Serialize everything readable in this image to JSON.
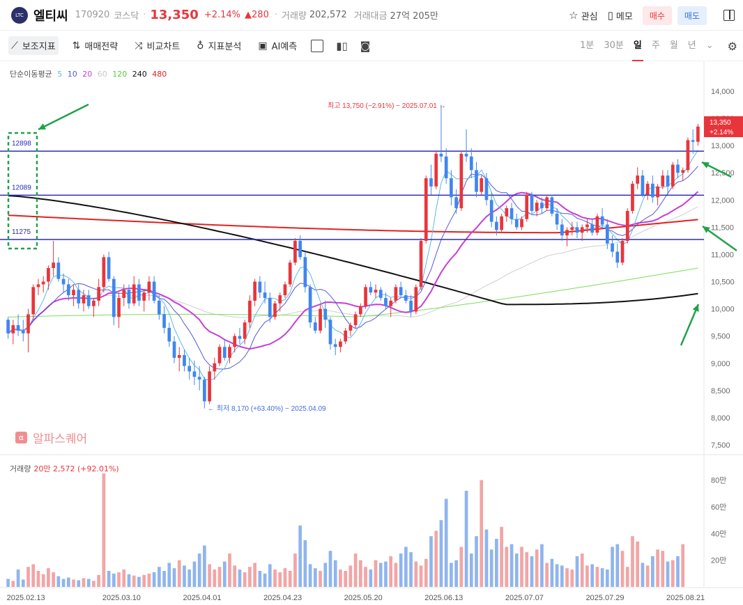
{
  "header": {
    "logo_text": "LTC",
    "name": "엘티씨",
    "code": "170920",
    "market": "코스닥",
    "dot": "·",
    "price": "13,350",
    "change_pct": "+2.14%",
    "change": "▲280",
    "volume_label": "거래량",
    "volume": "202,572",
    "amount_label": "거래대금",
    "amount": "27억 205만",
    "watch_label": "관심",
    "memo_label": "메모",
    "buy_label": "매수",
    "sell_label": "매도"
  },
  "toolbar": {
    "indicators": "보조지표",
    "strategy": "매매전략",
    "compare": "비교차트",
    "analysis": "지표분석",
    "ai": "AI예측",
    "periods": [
      "1분",
      "30분",
      "일",
      "주",
      "월",
      "년"
    ],
    "active_period": "일"
  },
  "legend": {
    "label": "단순이동평균",
    "periods": [
      "5",
      "10",
      "20",
      "60",
      "120",
      "240",
      "480"
    ]
  },
  "volume_legend": {
    "label": "거래량",
    "value": "20만 2,572 (+92.01%)"
  },
  "watermark": "알파스퀘어",
  "colors": {
    "up": "#e8353b",
    "down": "#3f86f0",
    "ma5": "#5bb8e8",
    "ma10": "#5656d8",
    "ma20": "#c63ed6",
    "ma60": "#cfcfcf",
    "ma120": "#7ddc5a",
    "ma240": "#111111",
    "ma480": "#e0221f",
    "hline": "#2b2bb8",
    "arrow": "#1fa24a"
  },
  "chart_data": {
    "type": "candlestick",
    "ylim": [
      7500,
      14000
    ],
    "yticks": [
      "14,000",
      "13,500",
      "13,000",
      "12,500",
      "12,000",
      "11,500",
      "11,000",
      "10,500",
      "10,000",
      "9,500",
      "9,000",
      "8,500",
      "8,000",
      "7,500"
    ],
    "xticks": [
      "2025.02.13",
      "2025.03.10",
      "2025.04.01",
      "2025.04.23",
      "2025.05.20",
      "2025.06.13",
      "2025.07.07",
      "2025.07.29",
      "2025.08.21"
    ],
    "volume_ticks": [
      "80만",
      "60만",
      "40만",
      "20만"
    ],
    "volume_ylim": [
      0,
      850000
    ],
    "last_price": "13,350",
    "last_pct": "+2.14%",
    "horizontal_lines": [
      {
        "label": "12898",
        "value": 12898
      },
      {
        "label": "12089",
        "value": 12089
      },
      {
        "label": "11275",
        "value": 11275
      }
    ],
    "annotations": {
      "high": "최고 13,750 (−2.91%) − 2025.07.01",
      "low": "최저 8,170 (+63.40%) − 2025.04.09"
    },
    "ohlc": [
      [
        9800,
        9850,
        9450,
        9550
      ],
      [
        9550,
        9800,
        9350,
        9700
      ],
      [
        9700,
        9900,
        9500,
        9600
      ],
      [
        9600,
        9800,
        9400,
        9550
      ],
      [
        9550,
        10000,
        9200,
        9900
      ],
      [
        9900,
        10450,
        9800,
        10400
      ],
      [
        10400,
        10550,
        10250,
        10450
      ],
      [
        10450,
        10600,
        10300,
        10500
      ],
      [
        10500,
        10800,
        10350,
        10750
      ],
      [
        10750,
        11250,
        10600,
        10850
      ],
      [
        10850,
        10950,
        10500,
        10550
      ],
      [
        10550,
        10650,
        10300,
        10450
      ],
      [
        10450,
        10550,
        10150,
        10250
      ],
      [
        10250,
        10450,
        10050,
        10350
      ],
      [
        10350,
        10450,
        10000,
        10100
      ],
      [
        10100,
        10350,
        9950,
        10250
      ],
      [
        10250,
        10350,
        10000,
        10050
      ],
      [
        10050,
        10200,
        9850,
        10150
      ],
      [
        10150,
        10550,
        10050,
        10400
      ],
      [
        10400,
        11000,
        10300,
        10950
      ],
      [
        10950,
        11050,
        10500,
        10550
      ],
      [
        10550,
        10600,
        9700,
        9850
      ],
      [
        9850,
        10300,
        9650,
        10200
      ],
      [
        10200,
        10450,
        10050,
        10350
      ],
      [
        10350,
        10450,
        10000,
        10100
      ],
      [
        10100,
        10600,
        10050,
        10450
      ],
      [
        10450,
        10550,
        10050,
        10150
      ],
      [
        10150,
        10350,
        9950,
        10300
      ],
      [
        10300,
        10600,
        10150,
        10500
      ],
      [
        10500,
        10600,
        10100,
        10150
      ],
      [
        10150,
        10250,
        9800,
        9900
      ],
      [
        9900,
        10050,
        9550,
        9650
      ],
      [
        9650,
        9750,
        9300,
        9400
      ],
      [
        9400,
        9500,
        9000,
        9100
      ],
      [
        9100,
        9300,
        8850,
        9150
      ],
      [
        9150,
        9250,
        8850,
        8950
      ],
      [
        8950,
        9100,
        8700,
        8850
      ],
      [
        8850,
        9050,
        8600,
        8750
      ],
      [
        8750,
        8950,
        8500,
        8700
      ],
      [
        8700,
        8750,
        8170,
        8300
      ],
      [
        8300,
        8950,
        8250,
        8850
      ],
      [
        8850,
        9100,
        8700,
        9000
      ],
      [
        9000,
        9350,
        8950,
        9300
      ],
      [
        9300,
        9450,
        9050,
        9100
      ],
      [
        9100,
        9350,
        9000,
        9300
      ],
      [
        9300,
        9550,
        9200,
        9500
      ],
      [
        9500,
        9650,
        9350,
        9450
      ],
      [
        9450,
        9800,
        9350,
        9750
      ],
      [
        9750,
        10250,
        9650,
        10150
      ],
      [
        10150,
        10550,
        10050,
        10500
      ],
      [
        10500,
        10600,
        10200,
        10300
      ],
      [
        10300,
        10500,
        10100,
        10200
      ],
      [
        10200,
        10300,
        9750,
        9850
      ],
      [
        9850,
        10150,
        9800,
        10100
      ],
      [
        10100,
        10300,
        9950,
        10250
      ],
      [
        10250,
        10500,
        10200,
        10450
      ],
      [
        10450,
        10900,
        10400,
        10850
      ],
      [
        10850,
        11300,
        10800,
        11250
      ],
      [
        11250,
        11350,
        10900,
        10950
      ],
      [
        10950,
        11050,
        10300,
        10400
      ],
      [
        10400,
        10450,
        9650,
        9750
      ],
      [
        9750,
        9850,
        9550,
        9600
      ],
      [
        9600,
        10100,
        9550,
        10000
      ],
      [
        10000,
        10150,
        9650,
        9800
      ],
      [
        9800,
        9850,
        9250,
        9350
      ],
      [
        9350,
        9450,
        9150,
        9300
      ],
      [
        9300,
        9450,
        9200,
        9400
      ],
      [
        9400,
        9650,
        9350,
        9600
      ],
      [
        9600,
        9750,
        9500,
        9700
      ],
      [
        9700,
        9950,
        9650,
        9900
      ],
      [
        9900,
        10100,
        9850,
        10050
      ],
      [
        10050,
        10450,
        10000,
        10400
      ],
      [
        10400,
        10500,
        10250,
        10300
      ],
      [
        10300,
        10450,
        10200,
        10350
      ],
      [
        10350,
        10400,
        10150,
        10200
      ],
      [
        10200,
        10300,
        10000,
        10050
      ],
      [
        10050,
        10200,
        9850,
        10150
      ],
      [
        10150,
        10450,
        10100,
        10400
      ],
      [
        10400,
        10500,
        10200,
        10250
      ],
      [
        10250,
        10350,
        10100,
        10150
      ],
      [
        10150,
        10250,
        9850,
        9950
      ],
      [
        9950,
        10450,
        9900,
        10400
      ],
      [
        10400,
        11300,
        10350,
        11250
      ],
      [
        11250,
        12450,
        11200,
        12400
      ],
      [
        12400,
        12650,
        12100,
        12250
      ],
      [
        12250,
        12900,
        12200,
        12850
      ],
      [
        12850,
        13750,
        12700,
        12800
      ],
      [
        12800,
        12950,
        12300,
        12400
      ],
      [
        12400,
        12550,
        11900,
        12050
      ],
      [
        12050,
        12200,
        11750,
        11850
      ],
      [
        11850,
        12900,
        11800,
        12850
      ],
      [
        12850,
        13300,
        12700,
        12800
      ],
      [
        12800,
        12950,
        12400,
        12550
      ],
      [
        12550,
        12700,
        12050,
        12150
      ],
      [
        12150,
        12450,
        12100,
        12400
      ],
      [
        12400,
        12500,
        11900,
        12000
      ],
      [
        12000,
        12150,
        11500,
        11600
      ],
      [
        11600,
        11700,
        11350,
        11450
      ],
      [
        11450,
        11750,
        11400,
        11700
      ],
      [
        11700,
        11900,
        11600,
        11850
      ],
      [
        11850,
        11950,
        11550,
        11650
      ],
      [
        11650,
        11750,
        11450,
        11500
      ],
      [
        11500,
        11700,
        11450,
        11650
      ],
      [
        11650,
        12150,
        11600,
        12100
      ],
      [
        12100,
        12150,
        11750,
        11800
      ],
      [
        11800,
        12000,
        11700,
        11950
      ],
      [
        11950,
        12050,
        11750,
        11850
      ],
      [
        11850,
        12100,
        11800,
        12050
      ],
      [
        12050,
        12100,
        11700,
        11750
      ],
      [
        11750,
        11850,
        11450,
        11550
      ],
      [
        11550,
        11650,
        11250,
        11350
      ],
      [
        11350,
        11500,
        11150,
        11450
      ],
      [
        11450,
        11600,
        11350,
        11500
      ],
      [
        11500,
        11600,
        11300,
        11400
      ],
      [
        11400,
        11550,
        11250,
        11500
      ],
      [
        11500,
        11650,
        11400,
        11550
      ],
      [
        11550,
        11650,
        11350,
        11400
      ],
      [
        11400,
        11750,
        11350,
        11700
      ],
      [
        11700,
        11850,
        11500,
        11550
      ],
      [
        11550,
        11650,
        11100,
        11200
      ],
      [
        11200,
        11350,
        10950,
        11050
      ],
      [
        11050,
        11200,
        10750,
        10850
      ],
      [
        10850,
        11300,
        10800,
        11250
      ],
      [
        11250,
        11850,
        11200,
        11800
      ],
      [
        11800,
        12350,
        11750,
        12300
      ],
      [
        12300,
        12600,
        12200,
        12450
      ],
      [
        12450,
        12550,
        12050,
        12100
      ],
      [
        12100,
        12350,
        12000,
        12300
      ],
      [
        12300,
        12450,
        11950,
        12050
      ],
      [
        12050,
        12300,
        11900,
        12250
      ],
      [
        12250,
        12550,
        12200,
        12450
      ],
      [
        12450,
        12550,
        12100,
        12250
      ],
      [
        12250,
        12700,
        12200,
        12650
      ],
      [
        12650,
        12750,
        12400,
        12500
      ],
      [
        12500,
        12600,
        12350,
        12550
      ],
      [
        12550,
        13150,
        12500,
        13100
      ],
      [
        13100,
        13300,
        12850,
        13070
      ],
      [
        13070,
        13400,
        13000,
        13350
      ]
    ],
    "volume": [
      60000,
      45000,
      130000,
      55000,
      150000,
      170000,
      120000,
      95000,
      140000,
      110000,
      80000,
      60000,
      70000,
      55000,
      50000,
      65000,
      60000,
      45000,
      90000,
      850000,
      120000,
      100000,
      110000,
      130000,
      95000,
      85000,
      75000,
      90000,
      100000,
      110000,
      150000,
      120000,
      180000,
      140000,
      200000,
      160000,
      130000,
      190000,
      250000,
      310000,
      170000,
      130000,
      150000,
      190000,
      250000,
      160000,
      130000,
      110000,
      150000,
      180000,
      120000,
      100000,
      170000,
      130000,
      110000,
      140000,
      120000,
      250000,
      460000,
      350000,
      170000,
      140000,
      120000,
      180000,
      270000,
      200000,
      130000,
      120000,
      160000,
      250000,
      200000,
      150000,
      130000,
      200000,
      180000,
      190000,
      230000,
      180000,
      250000,
      300000,
      260000,
      190000,
      160000,
      210000,
      380000,
      420000,
      500000,
      660000,
      180000,
      200000,
      300000,
      720000,
      250000,
      380000,
      800000,
      430000,
      280000,
      360000,
      450000,
      300000,
      320000,
      250000,
      300000,
      260000,
      230000,
      280000,
      320000,
      180000,
      210000,
      170000,
      160000,
      140000,
      130000,
      230000,
      250000,
      160000,
      170000,
      150000,
      140000,
      130000,
      300000,
      320000,
      270000,
      150000,
      380000,
      340000,
      180000,
      160000,
      230000,
      280000,
      270000,
      190000,
      200000,
      230000,
      320000
    ]
  }
}
